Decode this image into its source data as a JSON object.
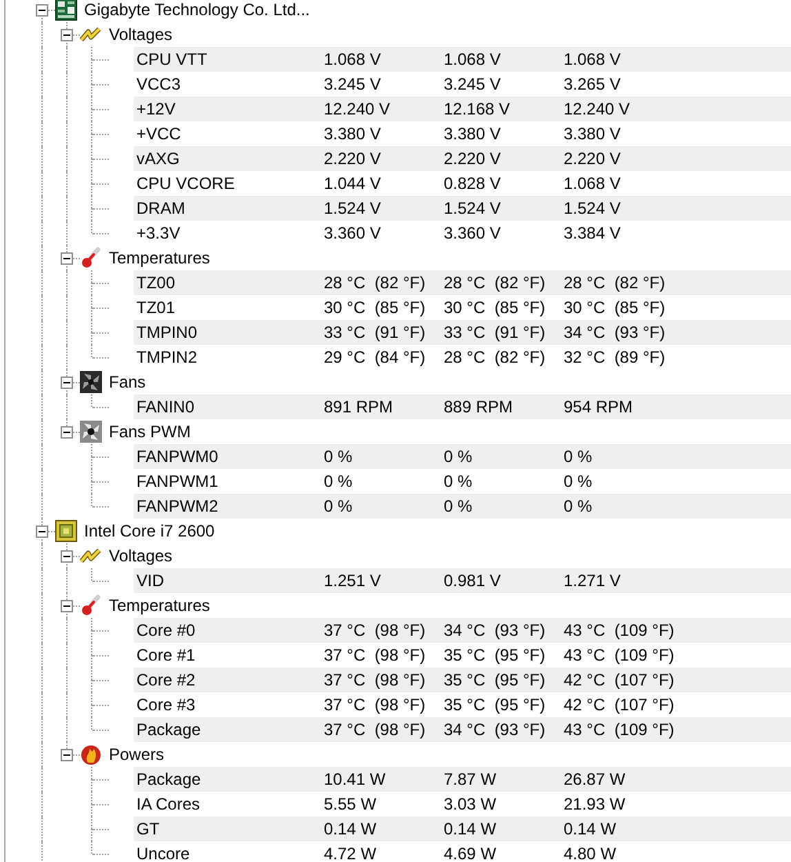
{
  "devices": [
    {
      "name": "Gigabyte Technology Co. Ltd...",
      "kind": "mainboard",
      "expanded": true,
      "groups": [
        {
          "name": "Voltages",
          "kind": "voltages",
          "expanded": true,
          "sensors": [
            {
              "name": "CPU VTT",
              "values": [
                "1.068 V",
                "1.068 V",
                "1.068 V"
              ]
            },
            {
              "name": "VCC3",
              "values": [
                "3.245 V",
                "3.245 V",
                "3.265 V"
              ]
            },
            {
              "name": "+12V",
              "values": [
                "12.240 V",
                "12.168 V",
                "12.240 V"
              ]
            },
            {
              "name": "+VCC",
              "values": [
                "3.380 V",
                "3.380 V",
                "3.380 V"
              ]
            },
            {
              "name": "vAXG",
              "values": [
                "2.220 V",
                "2.220 V",
                "2.220 V"
              ]
            },
            {
              "name": "CPU VCORE",
              "values": [
                "1.044 V",
                "0.828 V",
                "1.068 V"
              ]
            },
            {
              "name": "DRAM",
              "values": [
                "1.524 V",
                "1.524 V",
                "1.524 V"
              ]
            },
            {
              "name": "+3.3V",
              "values": [
                "3.360 V",
                "3.360 V",
                "3.384 V"
              ]
            }
          ]
        },
        {
          "name": "Temperatures",
          "kind": "temperatures",
          "expanded": true,
          "sensors": [
            {
              "name": "TZ00",
              "values": [
                "28 °C  (82 °F)",
                "28 °C  (82 °F)",
                "28 °C  (82 °F)"
              ]
            },
            {
              "name": "TZ01",
              "values": [
                "30 °C  (85 °F)",
                "30 °C  (85 °F)",
                "30 °C  (85 °F)"
              ]
            },
            {
              "name": "TMPIN0",
              "values": [
                "33 °C  (91 °F)",
                "33 °C  (91 °F)",
                "34 °C  (93 °F)"
              ]
            },
            {
              "name": "TMPIN2",
              "values": [
                "29 °C  (84 °F)",
                "28 °C  (82 °F)",
                "32 °C  (89 °F)"
              ]
            }
          ]
        },
        {
          "name": "Fans",
          "kind": "fans",
          "expanded": true,
          "sensors": [
            {
              "name": "FANIN0",
              "values": [
                "891 RPM",
                "889 RPM",
                "954 RPM"
              ]
            }
          ]
        },
        {
          "name": "Fans PWM",
          "kind": "fans_pwm",
          "expanded": true,
          "sensors": [
            {
              "name": "FANPWM0",
              "values": [
                "0 %",
                "0 %",
                "0 %"
              ]
            },
            {
              "name": "FANPWM1",
              "values": [
                "0 %",
                "0 %",
                "0 %"
              ]
            },
            {
              "name": "FANPWM2",
              "values": [
                "0 %",
                "0 %",
                "0 %"
              ]
            }
          ]
        }
      ]
    },
    {
      "name": "Intel Core i7 2600",
      "kind": "cpu",
      "expanded": true,
      "groups": [
        {
          "name": "Voltages",
          "kind": "voltages",
          "expanded": true,
          "sensors": [
            {
              "name": "VID",
              "values": [
                "1.251 V",
                "0.981 V",
                "1.271 V"
              ]
            }
          ]
        },
        {
          "name": "Temperatures",
          "kind": "temperatures",
          "expanded": true,
          "sensors": [
            {
              "name": "Core #0",
              "values": [
                "37 °C  (98 °F)",
                "34 °C  (93 °F)",
                "43 °C  (109 °F)"
              ]
            },
            {
              "name": "Core #1",
              "values": [
                "37 °C  (98 °F)",
                "35 °C  (95 °F)",
                "43 °C  (109 °F)"
              ]
            },
            {
              "name": "Core #2",
              "values": [
                "37 °C  (98 °F)",
                "35 °C  (95 °F)",
                "42 °C  (107 °F)"
              ]
            },
            {
              "name": "Core #3",
              "values": [
                "37 °C  (98 °F)",
                "35 °C  (95 °F)",
                "42 °C  (107 °F)"
              ]
            },
            {
              "name": "Package",
              "values": [
                "37 °C  (98 °F)",
                "34 °C  (93 °F)",
                "43 °C  (109 °F)"
              ]
            }
          ]
        },
        {
          "name": "Powers",
          "kind": "powers",
          "expanded": true,
          "sensors": [
            {
              "name": "Package",
              "values": [
                "10.41 W",
                "7.87 W",
                "26.87 W"
              ]
            },
            {
              "name": "IA Cores",
              "values": [
                "5.55 W",
                "3.03 W",
                "21.93 W"
              ]
            },
            {
              "name": "GT",
              "values": [
                "0.14 W",
                "0.14 W",
                "0.14 W"
              ]
            },
            {
              "name": "Uncore",
              "values": [
                "4.72 W",
                "4.69 W",
                "4.80 W"
              ]
            }
          ]
        }
      ]
    }
  ]
}
